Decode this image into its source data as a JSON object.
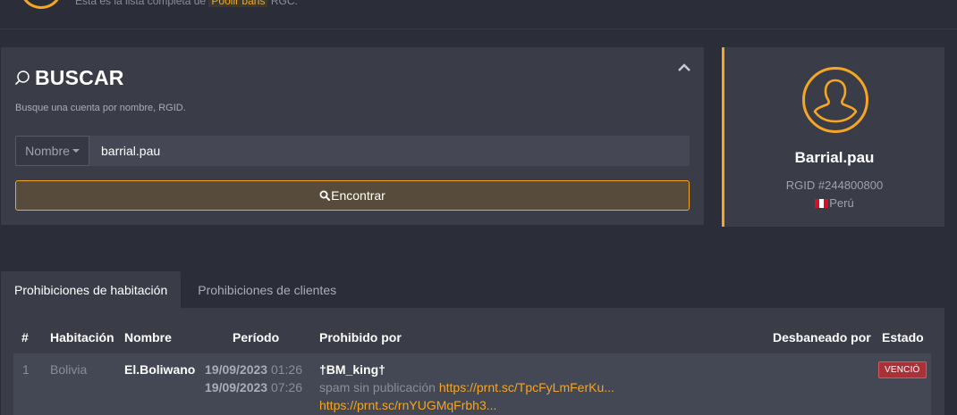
{
  "header": {
    "text_prefix": "Esta es la lista completa de",
    "highlight": "Poolir bans",
    "text_suffix": "RGC."
  },
  "search": {
    "title": "BUSCAR",
    "description": "Busque una cuenta por nombre, RGID.",
    "type_selected": "Nombre",
    "input_value": "barrial.pau",
    "button_label": "Encontrar"
  },
  "profile": {
    "name": "Barrial.pau",
    "rgid": "RGID #244800800",
    "country": "Perú"
  },
  "tabs": [
    {
      "label": "Prohibiciones de habitación"
    },
    {
      "label": "Prohibiciones de clientes"
    }
  ],
  "table": {
    "columns": {
      "num": "#",
      "room": "Habitación",
      "name": "Nombre",
      "period": "Período",
      "banned_by": "Prohibido por",
      "unbanned_by": "Desbaneado por",
      "status": "Estado"
    },
    "rows": [
      {
        "num": "1",
        "room": "Bolivia",
        "name": "El.Boliwano",
        "start_date": "19/09/2023",
        "start_time": "01:26",
        "end_date": "19/09/2023",
        "end_time": "07:26",
        "banned_by": "†BM_king†",
        "reason": "spam sin publicación",
        "link1": "https://prnt.sc/TpcFyLmFerKu...",
        "link2": "https://prnt.sc/rnYUGMqFrbh3...",
        "status": "VENCIÓ"
      }
    ]
  },
  "colors": {
    "accent": "#f5a623",
    "background": "#2b2e38",
    "card": "#3a3d48",
    "status_expired": "#a83238"
  }
}
